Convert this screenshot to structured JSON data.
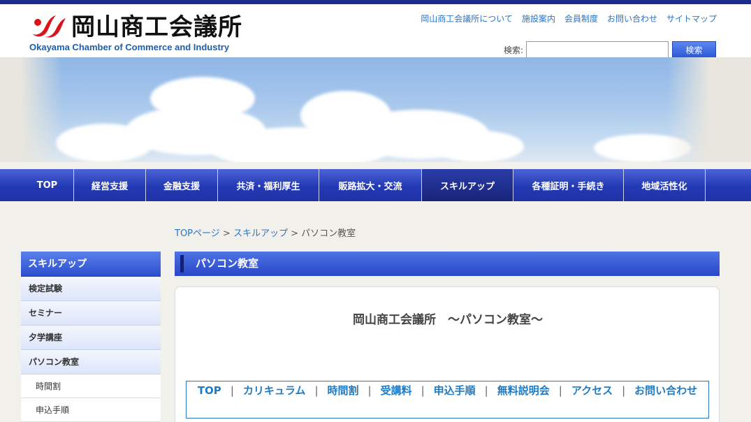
{
  "header": {
    "logo_jp": "岡山商工会議所",
    "logo_en": "Okayama Chamber of Commerce and Industry",
    "util_links": [
      "岡山商工会議所について",
      "施設案内",
      "会員制度",
      "お問い合わせ",
      "サイトマップ"
    ],
    "search_label": "検索:",
    "search_value": "",
    "search_button": "検索"
  },
  "main_nav": {
    "items": [
      "TOP",
      "経営支援",
      "金融支援",
      "共済・福利厚生",
      "販路拡大・交流",
      "スキルアップ",
      "各種証明・手続き",
      "地域活性化"
    ],
    "active": "スキルアップ"
  },
  "breadcrumb": {
    "home": "TOPページ",
    "parent": "スキルアップ",
    "current": "パソコン教室",
    "sep": ">"
  },
  "sidebar": {
    "heading": "スキルアップ",
    "items": [
      "検定試験",
      "セミナー",
      "夕学講座",
      "パソコン教室"
    ],
    "sub_items": [
      "時間割",
      "申込手順"
    ]
  },
  "page": {
    "heading": "パソコン教室",
    "title": "岡山商工会議所　～パソコン教室～",
    "subnav": [
      "TOP",
      "カリキュラム",
      "時間割",
      "受講料",
      "申込手順",
      "無料説明会",
      "アクセス",
      "お問い合わせ"
    ],
    "subnav_sep": "|"
  },
  "colors": {
    "brand_blue": "#2339b4",
    "link_blue": "#2b74c6",
    "logo_red": "#d9141b",
    "top_bar": "#1b2c8f"
  }
}
